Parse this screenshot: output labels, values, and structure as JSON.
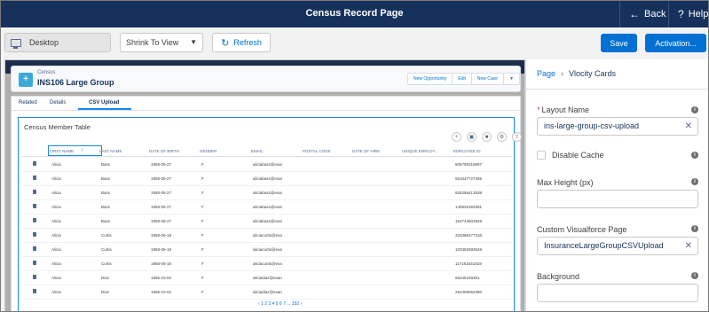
{
  "topbar": {
    "title": "Census Record Page",
    "back_label": "Back",
    "help_label": "Help"
  },
  "toolbar": {
    "device_label": "Desktop",
    "view_select_value": "Shrink To View",
    "refresh_label": "Refresh",
    "save_label": "Save",
    "activation_label": "Activation..."
  },
  "record": {
    "object_label": "Census",
    "name": "INS106 Large Group",
    "actions": [
      "New Opportunity",
      "Edit",
      "New Case"
    ]
  },
  "tabs": [
    "Related",
    "Details",
    "CSV Upload"
  ],
  "census_table": {
    "title": "Census Member Table",
    "columns": [
      "FIRST NAME",
      "LAST NAME",
      "DATE OF BIRTH",
      "GENDER",
      "EMAIL",
      "POSTAL CODE",
      "DATE OF HIRE",
      "UNIQUE EMPLOY...",
      "EMPLOYEE ID"
    ],
    "rows": [
      [
        "Alicia",
        "Bass",
        "1958-05-27",
        "F",
        "aliciabass@exar",
        "",
        "",
        "",
        "506799218897"
      ],
      [
        "Alicia",
        "Bass",
        "1958-05-27",
        "F",
        "aliciabass@exar",
        "",
        "",
        "",
        "551647727285"
      ],
      [
        "Alicia",
        "Bass",
        "1958-05-27",
        "F",
        "aliciabass@exar",
        "",
        "",
        "",
        "925256412538"
      ],
      [
        "Alicia",
        "Bass",
        "1958-05-27",
        "F",
        "aliciabass@exar",
        "",
        "",
        "",
        "140531053391"
      ],
      [
        "Alicia",
        "Bass",
        "1958-05-27",
        "F",
        "aliciabass@exar",
        "",
        "",
        "",
        "154744602848"
      ],
      [
        "Alicia",
        "Curtis",
        "1968-06-18",
        "F",
        "aliciacurtis@exa",
        "",
        "",
        "",
        "320386477236"
      ],
      [
        "Alicia",
        "Curtis",
        "1968-06-18",
        "F",
        "aliciacurtis@exa",
        "",
        "",
        "",
        "103382583549"
      ],
      [
        "Alicia",
        "Curtis",
        "1968-06-18",
        "F",
        "aliciacurtis@exa",
        "",
        "",
        "",
        "117161631819"
      ],
      [
        "Alicia",
        "Diaz",
        "1956-10-02",
        "F",
        "aliciadiaz@exan",
        "",
        "",
        "",
        "66245349351"
      ],
      [
        "Alicia",
        "Diaz",
        "1956-10-02",
        "F",
        "aliciadiaz@exan",
        "",
        "",
        "",
        "264359052380"
      ]
    ],
    "pager": "‹ 1 2 3 4 5 6 7 ... 152 ›"
  },
  "panel": {
    "breadcrumb_root": "Page",
    "breadcrumb_current": "Vlocity Cards",
    "layout_name_label": "Layout Name",
    "layout_name_value": "ins-large-group-csv-upload",
    "disable_cache_label": "Disable Cache",
    "max_height_label": "Max Height (px)",
    "max_height_value": "",
    "custom_vf_label": "Custom Visualforce Page",
    "custom_vf_value": "InsuranceLargeGroupCSVUpload",
    "background_label": "Background",
    "background_value": ""
  }
}
